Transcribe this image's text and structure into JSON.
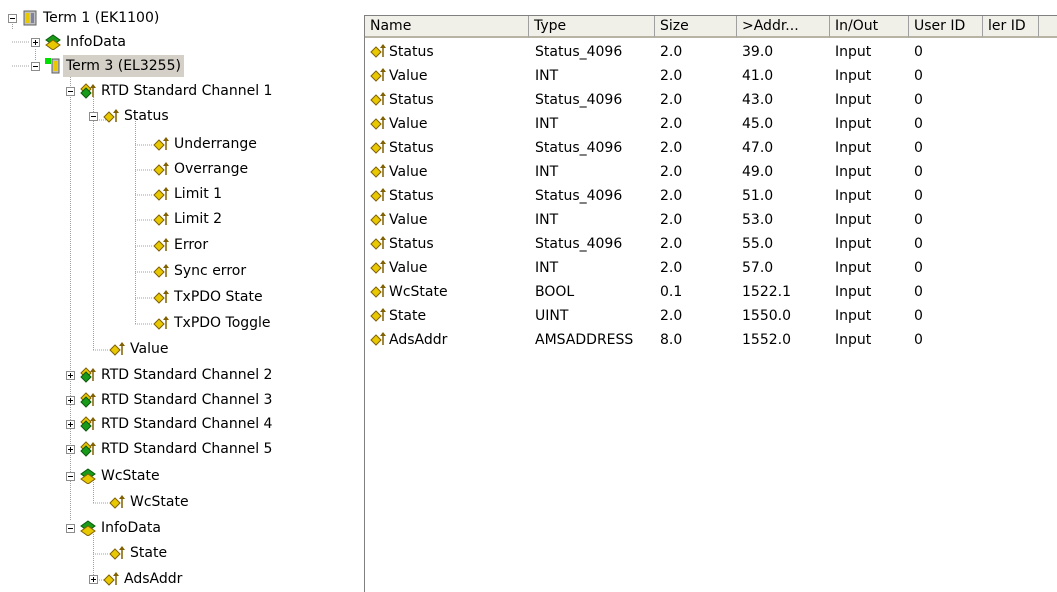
{
  "tree": {
    "nodes": [
      {
        "label": "Term 1 (EK1100)",
        "icon": "coupler-icon"
      },
      {
        "label": "InfoData",
        "icon": "green-var-group-icon"
      },
      {
        "label": "Term 3 (EL3255)",
        "icon": "terminal-icon"
      },
      {
        "label": "RTD Standard Channel 1",
        "icon": "input-var-group-icon"
      },
      {
        "label": "Status",
        "icon": "input-var-icon"
      },
      {
        "label": "Underrange",
        "icon": "input-var-icon"
      },
      {
        "label": "Overrange",
        "icon": "input-var-icon"
      },
      {
        "label": "Limit 1",
        "icon": "input-var-icon"
      },
      {
        "label": "Limit 2",
        "icon": "input-var-icon"
      },
      {
        "label": "Error",
        "icon": "input-var-icon"
      },
      {
        "label": "Sync error",
        "icon": "input-var-icon"
      },
      {
        "label": "TxPDO State",
        "icon": "input-var-icon"
      },
      {
        "label": "TxPDO Toggle",
        "icon": "input-var-icon"
      },
      {
        "label": "Value",
        "icon": "input-var-icon"
      },
      {
        "label": "RTD Standard Channel 2",
        "icon": "input-var-group-icon"
      },
      {
        "label": "RTD Standard Channel 3",
        "icon": "input-var-group-icon"
      },
      {
        "label": "RTD Standard Channel 4",
        "icon": "input-var-group-icon"
      },
      {
        "label": "RTD Standard Channel 5",
        "icon": "input-var-group-icon"
      },
      {
        "label": "WcState",
        "icon": "green-var-group-icon"
      },
      {
        "label": "WcState",
        "icon": "input-var-icon"
      },
      {
        "label": "InfoData",
        "icon": "green-var-group-icon"
      },
      {
        "label": "State",
        "icon": "input-var-icon"
      },
      {
        "label": "AdsAddr",
        "icon": "input-var-icon"
      }
    ]
  },
  "table": {
    "columns": [
      "Name",
      "Type",
      "Size",
      ">Addr...",
      "In/Out",
      "User ID",
      "ler ID"
    ],
    "rows": [
      [
        "Status",
        "Status_4096",
        "2.0",
        "39.0",
        "Input",
        "0"
      ],
      [
        "Value",
        "INT",
        "2.0",
        "41.0",
        "Input",
        "0"
      ],
      [
        "Status",
        "Status_4096",
        "2.0",
        "43.0",
        "Input",
        "0"
      ],
      [
        "Value",
        "INT",
        "2.0",
        "45.0",
        "Input",
        "0"
      ],
      [
        "Status",
        "Status_4096",
        "2.0",
        "47.0",
        "Input",
        "0"
      ],
      [
        "Value",
        "INT",
        "2.0",
        "49.0",
        "Input",
        "0"
      ],
      [
        "Status",
        "Status_4096",
        "2.0",
        "51.0",
        "Input",
        "0"
      ],
      [
        "Value",
        "INT",
        "2.0",
        "53.0",
        "Input",
        "0"
      ],
      [
        "Status",
        "Status_4096",
        "2.0",
        "55.0",
        "Input",
        "0"
      ],
      [
        "Value",
        "INT",
        "2.0",
        "57.0",
        "Input",
        "0"
      ],
      [
        "WcState",
        "BOOL",
        "0.1",
        "1522.1",
        "Input",
        "0"
      ],
      [
        "State",
        "UINT",
        "2.0",
        "1550.0",
        "Input",
        "0"
      ],
      [
        "AdsAddr",
        "AMSADDRESS",
        "8.0",
        "1552.0",
        "Input",
        "0"
      ]
    ]
  },
  "colors": {
    "selection": "#d4d0c8",
    "header_bg": "#f0efe8",
    "var_yellow": "#e8c800",
    "var_green": "#1a9a1a"
  }
}
